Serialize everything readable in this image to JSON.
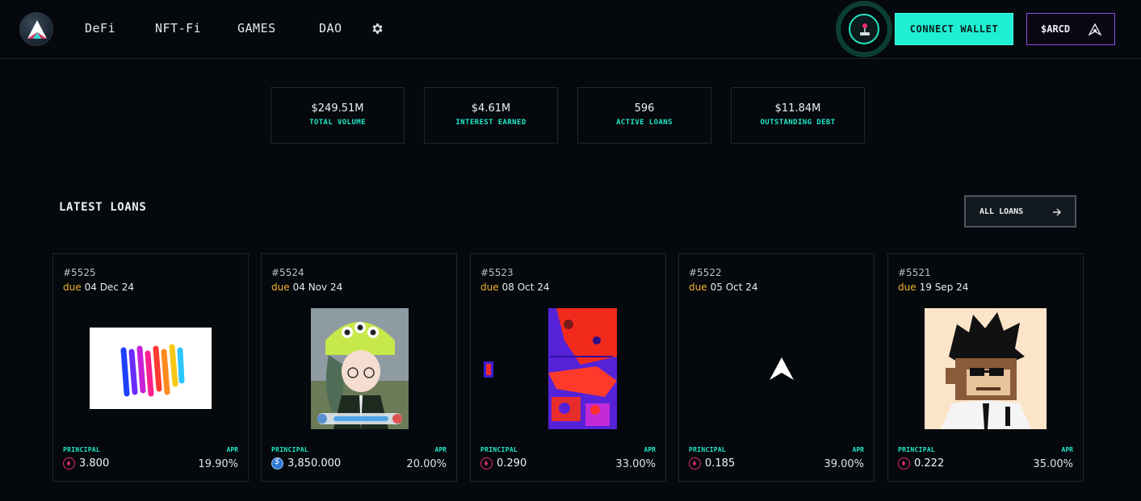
{
  "nav": {
    "items": [
      "DeFi",
      "NFT-Fi",
      "GAMES",
      "DAO"
    ],
    "settings_icon": "gear-icon",
    "connect_wallet": "CONNECT WALLET",
    "token_button": "$ARCD"
  },
  "stats": [
    {
      "value": "$249.51M",
      "label": "TOTAL VOLUME"
    },
    {
      "value": "$4.61M",
      "label": "INTEREST EARNED"
    },
    {
      "value": "596",
      "label": "ACTIVE LOANS"
    },
    {
      "value": "$11.84M",
      "label": "OUTSTANDING DEBT"
    }
  ],
  "loans_section": {
    "title": "LATEST LOANS",
    "all_button": "ALL LOANS"
  },
  "loans": [
    {
      "id": "#5525",
      "due_word": "due",
      "due": "04 Dec 24",
      "principal_label": "PRINCIPAL",
      "principal": "3.800",
      "token": "eth",
      "apr_label": "APR",
      "apr": "19.90%"
    },
    {
      "id": "#5524",
      "due_word": "due",
      "due": "04 Nov 24",
      "principal_label": "PRINCIPAL",
      "principal": "3,850.000",
      "token": "usdc",
      "apr_label": "APR",
      "apr": "20.00%"
    },
    {
      "id": "#5523",
      "due_word": "due",
      "due": "08 Oct 24",
      "principal_label": "PRINCIPAL",
      "principal": "0.290",
      "token": "eth",
      "apr_label": "APR",
      "apr": "33.00%"
    },
    {
      "id": "#5522",
      "due_word": "due",
      "due": "05 Oct 24",
      "principal_label": "PRINCIPAL",
      "principal": "0.185",
      "token": "eth",
      "apr_label": "APR",
      "apr": "39.00%"
    },
    {
      "id": "#5521",
      "due_word": "due",
      "due": "19 Sep 24",
      "principal_label": "PRINCIPAL",
      "principal": "0.222",
      "token": "eth",
      "apr_label": "APR",
      "apr": "35.00%"
    }
  ],
  "colors": {
    "accent": "#1ff0d3",
    "due": "#f1b52a",
    "token_border": "#8b4ce4",
    "eth": "#e8306f"
  }
}
